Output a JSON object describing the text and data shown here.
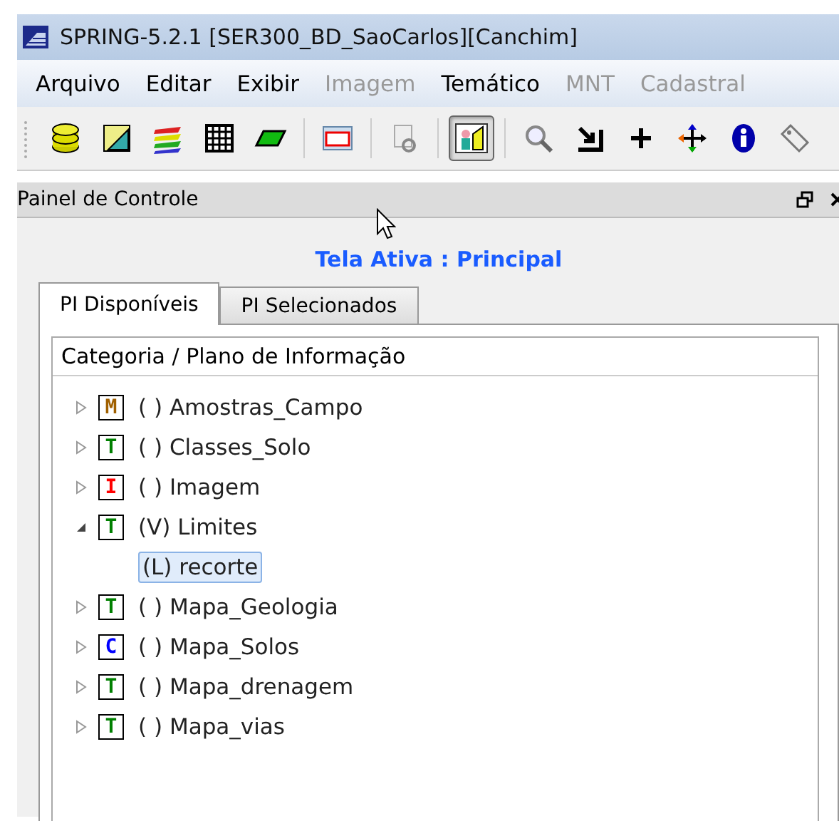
{
  "window": {
    "title": "SPRING-5.2.1 [SER300_BD_SaoCarlos][Canchim]"
  },
  "menu": [
    {
      "label": "Arquivo",
      "disabled": false
    },
    {
      "label": "Editar",
      "disabled": false
    },
    {
      "label": "Exibir",
      "disabled": false
    },
    {
      "label": "Imagem",
      "disabled": true
    },
    {
      "label": "Temático",
      "disabled": false
    },
    {
      "label": "MNT",
      "disabled": true
    },
    {
      "label": "Cadastral",
      "disabled": true
    }
  ],
  "toolbar": [
    {
      "selected": false
    },
    {
      "selected": false
    },
    {
      "selected": false
    },
    {
      "selected": false
    },
    {
      "selected": false
    },
    {
      "selected": false
    },
    {
      "selected": false
    },
    {
      "selected": true
    },
    {
      "selected": false
    },
    {
      "selected": false
    },
    {
      "selected": false
    },
    {
      "selected": false
    },
    {
      "selected": false
    },
    {
      "selected": false
    }
  ],
  "panel": {
    "title": "Painel de Controle",
    "active_screen": "Tela Ativa : Principal",
    "tabs": [
      {
        "label": "PI Disponíveis",
        "selected": true
      },
      {
        "label": "PI Selecionados",
        "selected": false
      }
    ],
    "tree_header": "Categoria / Plano de Informação",
    "tree": [
      {
        "badge": "M",
        "color": "#a06000",
        "label": "( ) Amostras_Campo",
        "expanded": false
      },
      {
        "badge": "T",
        "color": "#008000",
        "label": "( ) Classes_Solo",
        "expanded": false
      },
      {
        "badge": "I",
        "color": "#ff0000",
        "label": "( ) Imagem",
        "expanded": false
      },
      {
        "badge": "T",
        "color": "#008000",
        "label": "(V) Limites",
        "expanded": true,
        "children": [
          {
            "label": "(L) recorte",
            "selected": true
          }
        ]
      },
      {
        "badge": "T",
        "color": "#008000",
        "label": "( ) Mapa_Geologia",
        "expanded": false
      },
      {
        "badge": "C",
        "color": "#0000ff",
        "label": "( ) Mapa_Solos",
        "expanded": false
      },
      {
        "badge": "T",
        "color": "#008000",
        "label": "( ) Mapa_drenagem",
        "expanded": false
      },
      {
        "badge": "T",
        "color": "#008000",
        "label": "( ) Mapa_vias",
        "expanded": false
      }
    ]
  }
}
